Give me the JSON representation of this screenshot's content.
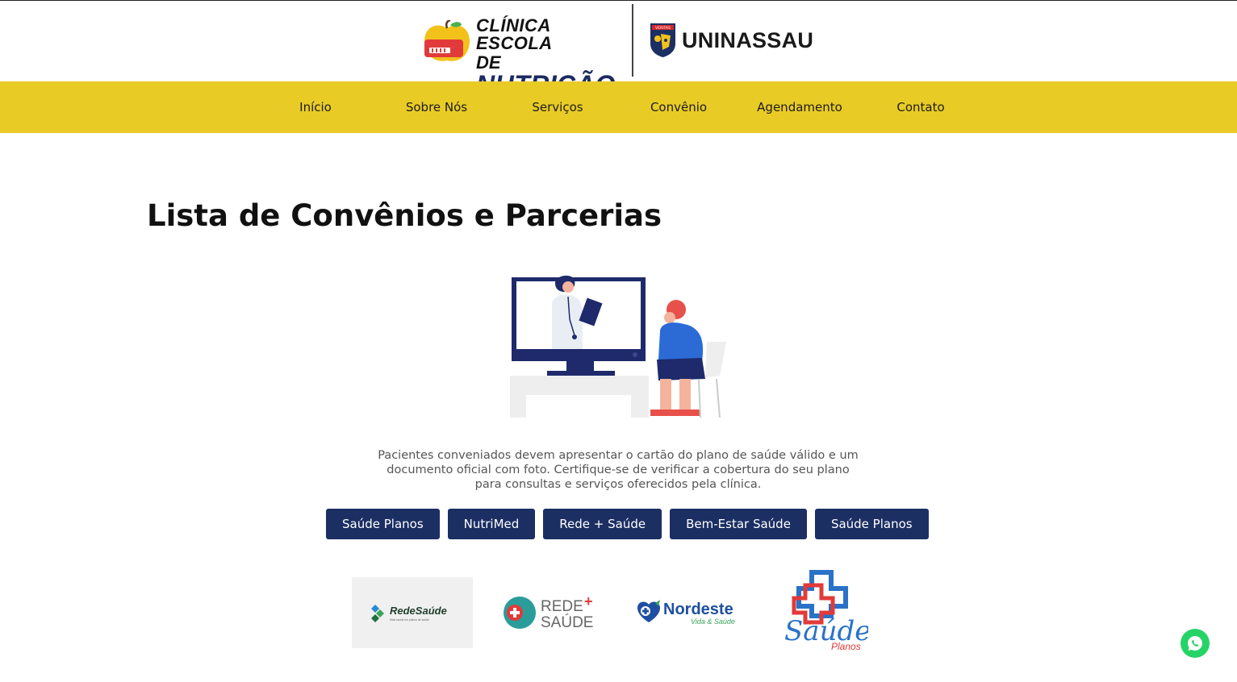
{
  "header": {
    "clinic_logo": {
      "line1": "CLÍNICA ESCOLA",
      "line2_prefix": "DE",
      "line2_main": "NUTRIÇÃO"
    },
    "university_logo": {
      "name": "UNINASSAU",
      "shield_text": "VERITAS"
    }
  },
  "nav": {
    "items": [
      {
        "label": "Início"
      },
      {
        "label": "Sobre Nós"
      },
      {
        "label": "Serviços"
      },
      {
        "label": "Convênio"
      },
      {
        "label": "Agendamento"
      },
      {
        "label": "Contato"
      }
    ]
  },
  "main": {
    "title": "Lista de Convênios e Parcerias",
    "description": "Pacientes conveniados devem apresentar o cartão do plano de saúde válido e um documento oficial com foto. Certifique-se de verificar a cobertura do seu plano para consultas e serviços oferecidos pela clínica.",
    "plans": [
      {
        "label": "Saúde Planos"
      },
      {
        "label": "NutriMed"
      },
      {
        "label": "Rede + Saúde"
      },
      {
        "label": "Bem-Estar Saúde"
      },
      {
        "label": "Saúde Planos"
      }
    ],
    "partners": [
      {
        "name": "RedeSaúde",
        "tagline": "Mais saúde em planos de saúde"
      },
      {
        "name_line1": "REDE",
        "plus": "+",
        "name_line2": "SAÚDE"
      },
      {
        "name": "Nordeste",
        "tagline": "Vida & Saúde"
      },
      {
        "name": "Saúde",
        "tagline": "Planos"
      }
    ]
  },
  "colors": {
    "nav_bg": "#e9cb26",
    "button_bg": "#1c2f63",
    "whatsapp": "#25d366"
  },
  "icons": {
    "whatsapp": "whatsapp-icon",
    "illustration": "telemedicine-illustration"
  }
}
